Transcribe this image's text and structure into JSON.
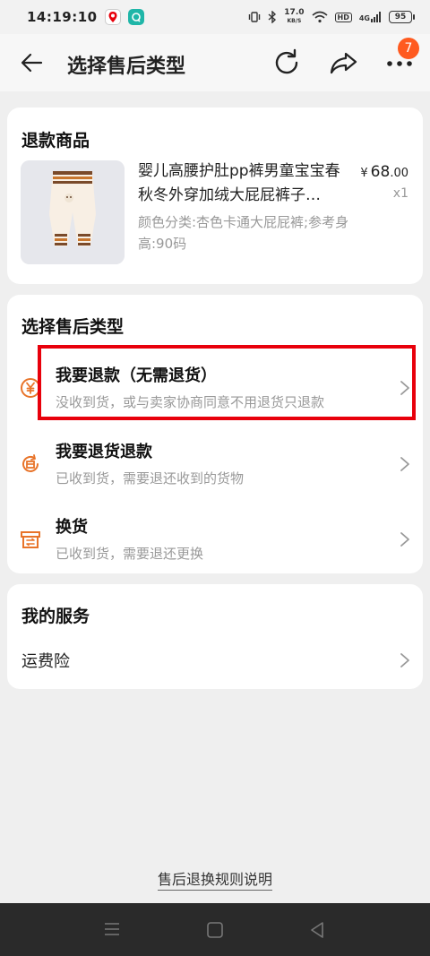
{
  "status_bar": {
    "time": "14:19:10",
    "net_speed_value": "17.0",
    "net_speed_unit": "KB/S",
    "hd": "HD",
    "signal": "4G",
    "battery": "95"
  },
  "header": {
    "title": "选择售后类型",
    "badge_count": "7"
  },
  "product": {
    "section_title": "退款商品",
    "name": "婴儿高腰护肚pp裤男童宝宝春秋冬外穿加绒大屁屁裤子…",
    "spec": "颜色分类:杏色卡通大屁屁裤;参考身高:90码",
    "price_symbol": "¥",
    "price_int": "68",
    "price_dec": ".00",
    "quantity": "x1"
  },
  "aftersale": {
    "section_title": "选择售后类型",
    "options": [
      {
        "title": "我要退款（无需退货）",
        "desc": "没收到货，或与卖家协商同意不用退货只退款",
        "icon": "yen-circle-icon"
      },
      {
        "title": "我要退货退款",
        "desc": "已收到货，需要退还收到的货物",
        "icon": "return-box-icon"
      },
      {
        "title": "换货",
        "desc": "已收到货，需要退还更换",
        "icon": "exchange-box-icon"
      }
    ]
  },
  "services": {
    "section_title": "我的服务",
    "items": [
      {
        "label": "运费险"
      }
    ]
  },
  "rules_link": "售后退换规则说明",
  "colors": {
    "accent": "#e8742a",
    "highlight": "#e8000b",
    "badge": "#ff5a1f"
  }
}
